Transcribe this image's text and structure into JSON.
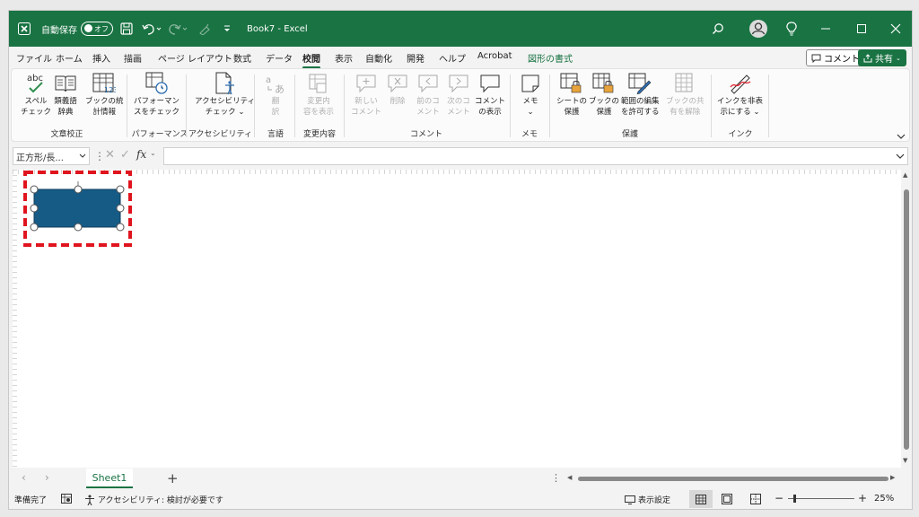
{
  "titlebar": {
    "autosave_label": "自動保存",
    "autosave_state": "オフ",
    "title": "Book7 - Excel"
  },
  "tabs": [
    "ファイル",
    "ホーム",
    "挿入",
    "描画",
    "ページ レイアウト",
    "数式",
    "データ",
    "校閲",
    "表示",
    "自動化",
    "開発",
    "ヘルプ",
    "Acrobat",
    "図形の書式"
  ],
  "active_tab": "校閲",
  "comment_button": "コメント",
  "share_button": "共有",
  "ribbon": {
    "spell_icon_text": "abc",
    "groups": {
      "proofing": "文章校正",
      "performance": "パフォーマンス",
      "accessibility": "アクセシビリティ",
      "language": "言語",
      "changes": "変更内容",
      "comments": "コメント",
      "notes": "メモ",
      "protect": "保護",
      "ink": "インク"
    },
    "buttons": {
      "spell": [
        "スペル",
        "チェック"
      ],
      "thesaurus": [
        "類義語",
        "辞典"
      ],
      "workbook_stats": [
        "ブックの統",
        "計情報"
      ],
      "performance": [
        "パフォーマン",
        "スをチェック"
      ],
      "accessibility": [
        "アクセシビリティ",
        "チェック ⌄"
      ],
      "translate": [
        "翻",
        "訳"
      ],
      "show_changes": [
        "変更内",
        "容を表示"
      ],
      "new_comment": [
        "新しい",
        "コメント"
      ],
      "delete": [
        "削除",
        ""
      ],
      "prev_comment": [
        "前のコ",
        "メント"
      ],
      "next_comment": [
        "次のコ",
        "メント"
      ],
      "show_comments": [
        "コメント",
        "の表示"
      ],
      "notes": [
        "メモ",
        "⌄"
      ],
      "protect_sheet": [
        "シートの",
        "保護"
      ],
      "protect_workbook": [
        "ブックの",
        "保護"
      ],
      "allow_edit": [
        "範囲の編集",
        "を許可する"
      ],
      "unshare": [
        "ブックの共",
        "有を解除"
      ],
      "hide_ink": [
        "インクを非表",
        "示にする ⌄"
      ]
    }
  },
  "formula_bar": {
    "name_box": "正方形/長...",
    "fx": "fx"
  },
  "sheet_tab": "Sheet1",
  "status": {
    "ready": "準備完了",
    "accessibility": "アクセシビリティ: 検討が必要です",
    "display_settings": "表示設定",
    "zoom": "25%"
  },
  "colors": {
    "brand": "#1a7343",
    "shape_fill": "#155b86",
    "highlight": "#e0141e"
  }
}
